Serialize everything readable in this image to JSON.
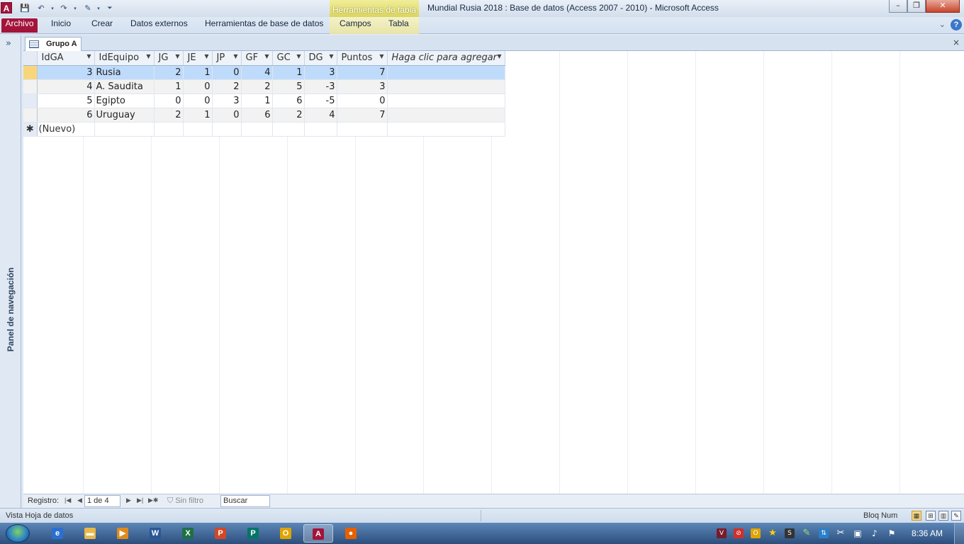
{
  "window": {
    "app_icon": "A",
    "title": "Mundial Rusia 2018 : Base de datos (Access 2007 - 2010)  -  Microsoft Access",
    "context_tab_header": "Herramientas de tabla",
    "controls": [
      "minimize-icon",
      "restore-icon",
      "close-icon"
    ]
  },
  "ribbon": {
    "file_tab": "Archivo",
    "tabs": [
      "Inicio",
      "Crear",
      "Datos externos",
      "Herramientas de base de datos",
      "Campos",
      "Tabla"
    ]
  },
  "nav_pane": {
    "toggle": "»",
    "label": "Panel de navegación"
  },
  "document": {
    "tab_label": "Grupo A",
    "close_symbol": "×"
  },
  "table": {
    "columns": [
      {
        "label": "IdGA",
        "width": 81
      },
      {
        "label": "IdEquipo",
        "width": 84
      },
      {
        "label": "JG",
        "width": 41
      },
      {
        "label": "JE",
        "width": 41
      },
      {
        "label": "JP",
        "width": 41
      },
      {
        "label": "GF",
        "width": 44
      },
      {
        "label": "GC",
        "width": 45
      },
      {
        "label": "DG",
        "width": 46
      },
      {
        "label": "Puntos",
        "width": 71
      },
      {
        "label": "Haga clic para agregar",
        "width": 166
      }
    ],
    "rows": [
      [
        "3",
        "Rusia",
        "2",
        "1",
        "0",
        "4",
        "1",
        "3",
        "7"
      ],
      [
        "4",
        "A. Saudita",
        "1",
        "0",
        "2",
        "2",
        "5",
        "-3",
        "3"
      ],
      [
        "5",
        "Egipto",
        "0",
        "0",
        "3",
        "1",
        "6",
        "-5",
        "0"
      ],
      [
        "6",
        "Uruguay",
        "2",
        "1",
        "0",
        "6",
        "2",
        "4",
        "7"
      ]
    ],
    "selected_row_index": 0,
    "new_row_marker": "✱",
    "new_row_label": "(Nuevo)"
  },
  "record_nav": {
    "label": "Registro:",
    "current": "1 de 4",
    "filter": "Sin filtro",
    "search": "Buscar"
  },
  "statusbar": {
    "left": "Vista Hoja de datos",
    "num_lock": "Bloq Num"
  },
  "taskbar": {
    "apps": [
      {
        "name": "internet-explorer",
        "glyph": "e",
        "color": "#2b6fd0",
        "active": false
      },
      {
        "name": "explorer",
        "glyph": "▬",
        "color": "#e8b84a",
        "active": false
      },
      {
        "name": "media-player",
        "glyph": "▶",
        "color": "#e08a1e",
        "active": false
      },
      {
        "name": "word",
        "glyph": "W",
        "color": "#2b5797",
        "active": false
      },
      {
        "name": "excel",
        "glyph": "X",
        "color": "#1e7145",
        "active": false
      },
      {
        "name": "powerpoint",
        "glyph": "P",
        "color": "#d24726",
        "active": false
      },
      {
        "name": "publisher",
        "glyph": "P",
        "color": "#077568",
        "active": false
      },
      {
        "name": "outlook",
        "glyph": "O",
        "color": "#e0a400",
        "active": false
      },
      {
        "name": "access",
        "glyph": "A",
        "color": "#a4143a",
        "active": true
      },
      {
        "name": "firefox",
        "glyph": "●",
        "color": "#e66000",
        "active": false
      }
    ],
    "clock": "8:36 AM"
  }
}
